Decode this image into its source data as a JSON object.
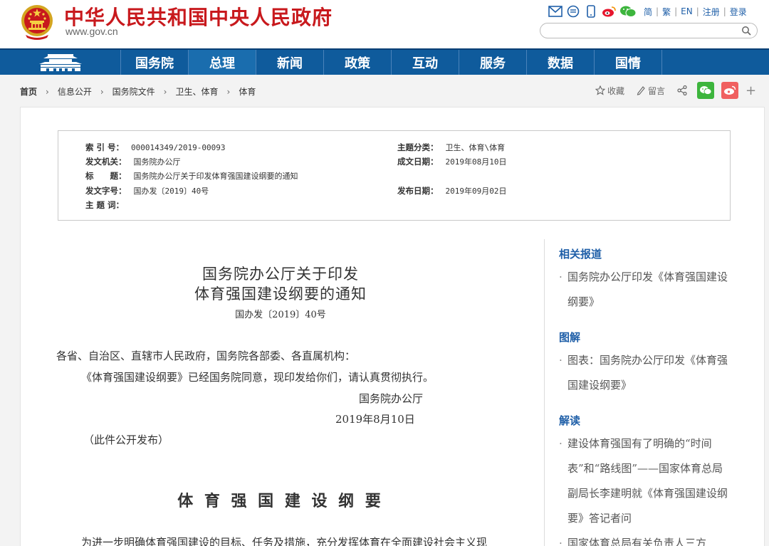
{
  "header": {
    "site_title": "中华人民共和国中央人民政府",
    "site_domain": "www.gov.cn",
    "links": [
      "简",
      "繁",
      "EN",
      "注册",
      "登录"
    ],
    "seps": [
      "|",
      "|",
      "|",
      "|"
    ],
    "search_placeholder": ""
  },
  "nav": {
    "items": [
      {
        "label": "国务院"
      },
      {
        "label": "总理"
      },
      {
        "label": "新闻"
      },
      {
        "label": "政策"
      },
      {
        "label": "互动"
      },
      {
        "label": "服务"
      },
      {
        "label": "数据"
      },
      {
        "label": "国情"
      }
    ]
  },
  "breadcrumb": {
    "items": [
      "首页",
      "信息公开",
      "国务院文件",
      "卫生、体育",
      "体育"
    ],
    "sep": "›"
  },
  "tools": {
    "favorite": "收藏",
    "comment": "留言",
    "plus": "+"
  },
  "meta": {
    "index_label": "索 引 号：",
    "index_value": "000014349/2019-00093",
    "topic_label": "主题分类：",
    "topic_value": "卫生、体育\\体育",
    "issuer_label": "发文机关：",
    "issuer_value": "国务院办公厅",
    "date_made_label": "成文日期：",
    "date_made_value": "2019年08月10日",
    "title_label": "标　　题：",
    "title_value": "国务院办公厅关于印发体育强国建设纲要的通知",
    "docno_label": "发文字号：",
    "docno_value": "国办发〔2019〕40号",
    "pub_date_label": "发布日期：",
    "pub_date_value": "2019年09月02日",
    "keywords_label": "主 题 词：",
    "keywords_value": ""
  },
  "article": {
    "title_line1": "国务院办公厅关于印发",
    "title_line2": "体育强国建设纲要的通知",
    "doc_no": "国办发〔2019〕40号",
    "salutation": "各省、自治区、直辖市人民政府，国务院各部委、各直属机构：",
    "body": "《体育强国建设纲要》已经国务院同意，现印发给你们，请认真贯彻执行。",
    "signature": "国务院办公厅",
    "sign_date": "2019年8月10日",
    "public_note": "（此件公开发布）",
    "section_title": "体 育 强 国 建 设 纲 要",
    "intro": "为进一步明确体育强国建设的目标、任务及措施，充分发挥体育在全面建设社会主义现"
  },
  "sidebar": {
    "sections": [
      {
        "heading": "相关报道",
        "items": [
          "国务院办公厅印发《体育强国建设纲要》"
        ]
      },
      {
        "heading": "图解",
        "items": [
          "图表：国务院办公厅印发《体育强国建设纲要》"
        ]
      },
      {
        "heading": "解读",
        "items": [
          "建设体育强国有了明确的“时间表”和“路线图”——国家体育总局副局长李建明就《体育强国建设纲要》答记者问",
          "国家体育总局有关负责人三方"
        ]
      }
    ]
  },
  "colors": {
    "brand_red": "#c8191d",
    "nav_blue": "#0f5b9c",
    "link_blue": "#1f5fa8"
  }
}
